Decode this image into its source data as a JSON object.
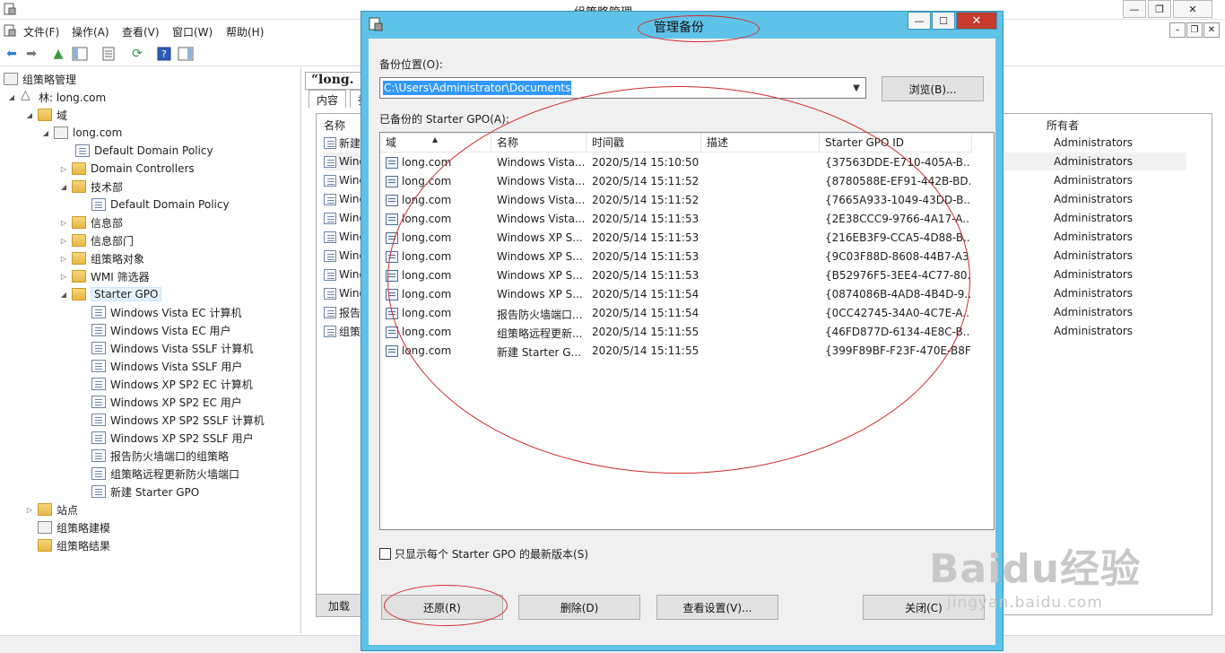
{
  "window": {
    "title": "组策略管理"
  },
  "menu": {
    "items": [
      "文件(F)",
      "操作(A)",
      "查看(V)",
      "窗口(W)",
      "帮助(H)"
    ]
  },
  "tree": {
    "root": "组策略管理",
    "forest": "林: long.com",
    "domains": "域",
    "domain": "long.com",
    "default_domain_policy": "Default Domain Policy",
    "domain_controllers": "Domain Controllers",
    "tech_dept": "技术部",
    "tech_default_policy": "Default Domain Policy",
    "info_dept": "信息部",
    "info_dept2": "信息部门",
    "gpo_objects": "组策略对象",
    "wmi_filters": "WMI 筛选器",
    "starter_gpo": "Starter GPO",
    "starter_items": [
      "Windows Vista EC 计算机",
      "Windows Vista EC 用户",
      "Windows Vista SSLF 计算机",
      "Windows Vista SSLF 用户",
      "Windows XP SP2 EC 计算机",
      "Windows XP SP2 EC 用户",
      "Windows XP SP2 SSLF 计算机",
      "Windows XP SP2 SSLF 用户",
      "报告防火墙端口的组策略",
      "组策略远程更新防火墙端口",
      "新建 Starter GPO"
    ],
    "sites": "站点",
    "modeling": "组策略建模",
    "results": "组策略结果"
  },
  "right_pane": {
    "heading": "“long.",
    "tab_content": "内容",
    "tab_second": "委",
    "col_name": "名称",
    "col_owner": "所有者",
    "rows": [
      {
        "name": "新建",
        "owner": "Administrators"
      },
      {
        "name": "Wind",
        "owner": "Administrators"
      },
      {
        "name": "Wind",
        "owner": "Administrators"
      },
      {
        "name": "Wind",
        "owner": "Administrators"
      },
      {
        "name": "Wind",
        "owner": "Administrators"
      },
      {
        "name": "Wind",
        "owner": "Administrators"
      },
      {
        "name": "Wind",
        "owner": "Administrators"
      },
      {
        "name": "Wind",
        "owner": "Administrators"
      },
      {
        "name": "Wind",
        "owner": "Administrators"
      },
      {
        "name": "报告",
        "owner": "Administrators"
      },
      {
        "name": "组策",
        "owner": "Administrators"
      }
    ],
    "load_button": "加载"
  },
  "dialog": {
    "title": "管理备份",
    "backup_location_label": "备份位置(O):",
    "backup_location_value": "C:\\Users\\Administrator\\Documents",
    "browse_button": "浏览(B)...",
    "backed_up_label": "已备份的 Starter GPO(A):",
    "columns": [
      "域",
      "名称",
      "时间戳",
      "描述",
      "Starter GPO ID"
    ],
    "rows": [
      {
        "domain": "long.com",
        "name": "Windows Vista...",
        "time": "2020/5/14 15:10:50",
        "desc": "",
        "id": "{37563DDE-E710-405A-B..."
      },
      {
        "domain": "long.com",
        "name": "Windows Vista...",
        "time": "2020/5/14 15:11:52",
        "desc": "",
        "id": "{8780588E-EF91-442B-BD..."
      },
      {
        "domain": "long.com",
        "name": "Windows Vista...",
        "time": "2020/5/14 15:11:52",
        "desc": "",
        "id": "{7665A933-1049-43DD-B..."
      },
      {
        "domain": "long.com",
        "name": "Windows Vista...",
        "time": "2020/5/14 15:11:53",
        "desc": "",
        "id": "{2E38CCC9-9766-4A17-A..."
      },
      {
        "domain": "long.com",
        "name": "Windows XP S...",
        "time": "2020/5/14 15:11:53",
        "desc": "",
        "id": "{216EB3F9-CCA5-4D88-B..."
      },
      {
        "domain": "long.com",
        "name": "Windows XP S...",
        "time": "2020/5/14 15:11:53",
        "desc": "",
        "id": "{9C03F88D-8608-44B7-A3..."
      },
      {
        "domain": "long.com",
        "name": "Windows XP S...",
        "time": "2020/5/14 15:11:53",
        "desc": "",
        "id": "{B52976F5-3EE4-4C77-80..."
      },
      {
        "domain": "long.com",
        "name": "Windows XP S...",
        "time": "2020/5/14 15:11:54",
        "desc": "",
        "id": "{0874086B-4AD8-4B4D-9..."
      },
      {
        "domain": "long.com",
        "name": "报告防火墙端口...",
        "time": "2020/5/14 15:11:54",
        "desc": "",
        "id": "{0CC42745-34A0-4C7E-A..."
      },
      {
        "domain": "long.com",
        "name": "组策略远程更新...",
        "time": "2020/5/14 15:11:55",
        "desc": "",
        "id": "{46FD877D-6134-4E8C-B..."
      },
      {
        "domain": "long.com",
        "name": "新建 Starter G...",
        "time": "2020/5/14 15:11:55",
        "desc": "",
        "id": "{399F89BF-F23F-470E-B8F..."
      }
    ],
    "checkbox_label": "只显示每个 Starter GPO 的最新版本(S)",
    "restore_button": "还原(R)",
    "delete_button": "删除(D)",
    "view_settings_button": "查看设置(V)...",
    "close_button": "关闭(C)"
  },
  "watermark": {
    "main": "Baidu经验",
    "sub": "jingyan.baidu.com"
  },
  "colors": {
    "dialog_frame": "#5fc3e8",
    "close_button": "#c73a2e",
    "selection": "#3399ff",
    "annotation": "#d0292f"
  }
}
